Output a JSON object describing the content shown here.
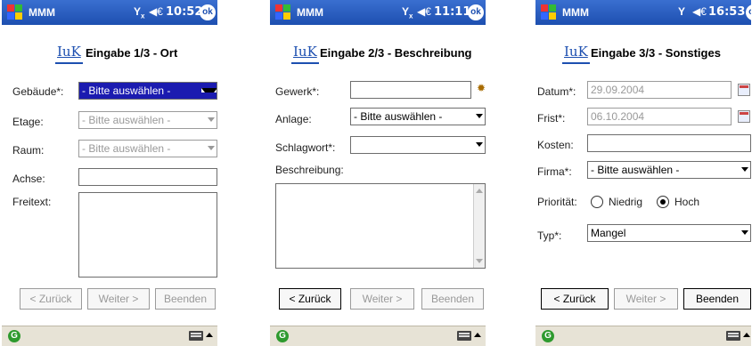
{
  "app_title": "MMM",
  "logo_text": "IuK",
  "status": {
    "signal": "Y",
    "signal_sub": "x",
    "volume": "◀€"
  },
  "ok": "ok",
  "screens": [
    {
      "clock": "10:52",
      "title": "Eingabe 1/3 - Ort",
      "fields": {
        "gebaeude": {
          "label": "Gebäude*:",
          "value": "- Bitte auswählen -"
        },
        "etage": {
          "label": "Etage:",
          "value": "- Bitte auswählen -"
        },
        "raum": {
          "label": "Raum:",
          "value": "- Bitte auswählen -"
        },
        "achse": {
          "label": "Achse:",
          "value": ""
        },
        "freitext": {
          "label": "Freitext:"
        }
      },
      "buttons": {
        "back": "< Zurück",
        "next": "Weiter >",
        "finish": "Beenden"
      }
    },
    {
      "clock": "11:11",
      "title": "Eingabe 2/3 - Beschreibung",
      "fields": {
        "gewerk": {
          "label": "Gewerk*:",
          "value": ""
        },
        "anlage": {
          "label": "Anlage:",
          "value": "- Bitte auswählen -"
        },
        "schlagwort": {
          "label": "Schlagwort*:",
          "value": ""
        },
        "beschreibung": {
          "label": "Beschreibung:"
        }
      },
      "buttons": {
        "back": "< Zurück",
        "next": "Weiter >",
        "finish": "Beenden"
      }
    },
    {
      "clock": "16:53",
      "title": "Eingabe 3/3 - Sonstiges",
      "fields": {
        "datum": {
          "label": "Datum*:",
          "value": "29.09.2004"
        },
        "frist": {
          "label": "Frist*:",
          "value": "06.10.2004"
        },
        "kosten": {
          "label": "Kosten:",
          "value": ""
        },
        "firma": {
          "label": "Firma*:",
          "value": "- Bitte auswählen -"
        },
        "prioritaet": {
          "label": "Priorität:",
          "options": [
            "Niedrig",
            "Hoch"
          ],
          "selected": "Hoch"
        },
        "typ": {
          "label": "Typ*:",
          "value": "Mangel"
        }
      },
      "buttons": {
        "back": "< Zurück",
        "next": "Weiter >",
        "finish": "Beenden"
      }
    }
  ]
}
